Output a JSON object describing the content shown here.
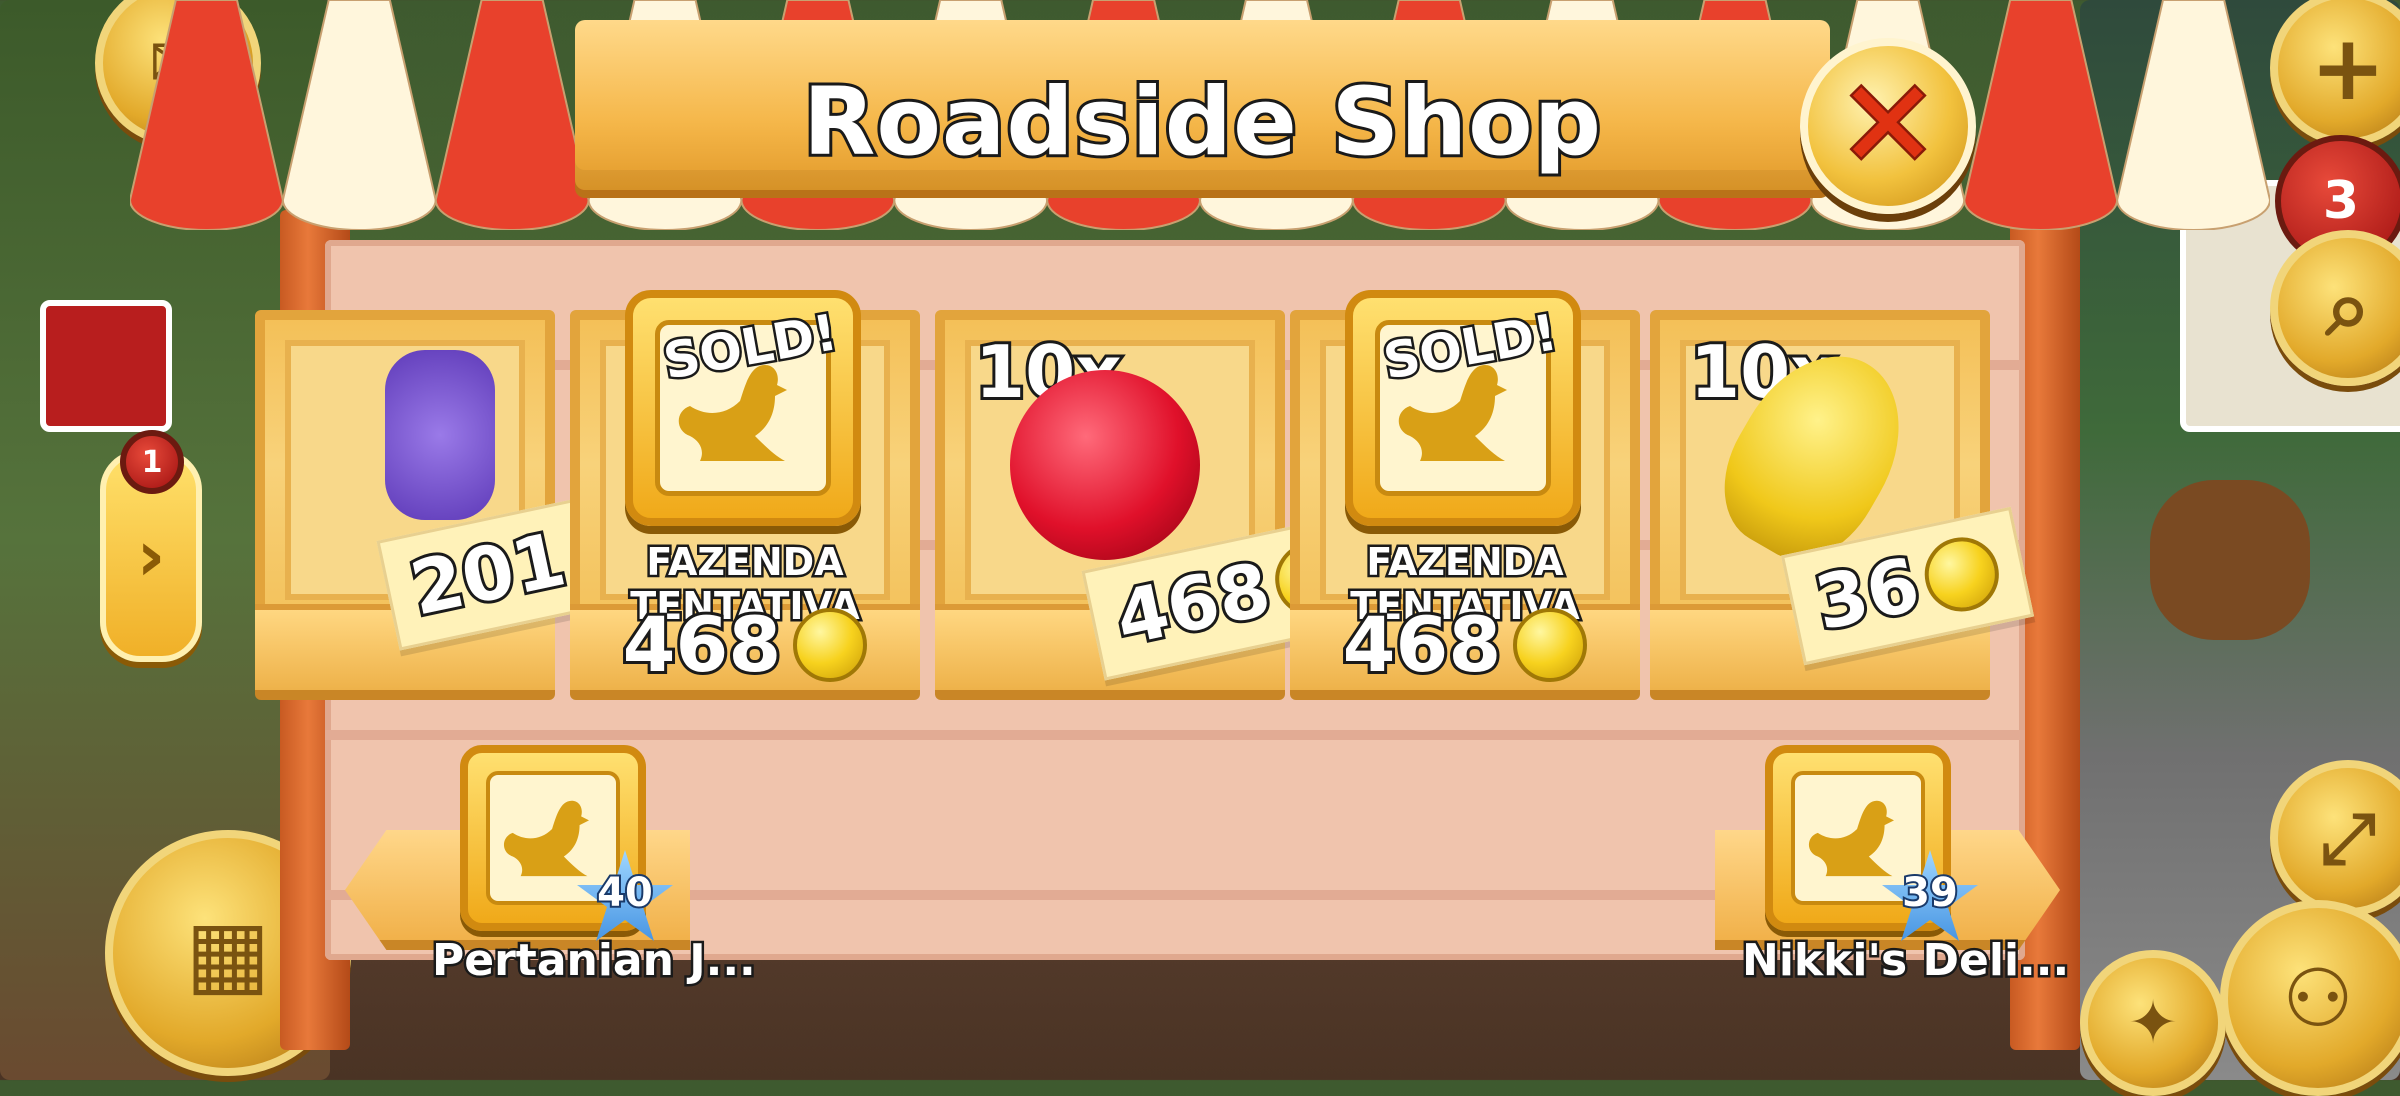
{
  "title": "Roadside Shop",
  "close_icon": "close-x-icon",
  "slots": [
    {
      "kind": "item",
      "item_icon": "lavender-icon",
      "price": "201"
    },
    {
      "kind": "sold",
      "sold_label": "SOLD!",
      "buyer": "FAZENDA TENTATIVA",
      "price": "468"
    },
    {
      "kind": "item",
      "quantity": "10x",
      "item_icon": "raspberry-icon",
      "price": "468"
    },
    {
      "kind": "sold",
      "sold_label": "SOLD!",
      "buyer": "FAZENDA TENTATIVA",
      "price": "468"
    },
    {
      "kind": "item",
      "quantity": "10x",
      "item_icon": "wheat-icon",
      "price": "36"
    }
  ],
  "neighbors": {
    "left": {
      "name": "Pertanian J...",
      "level": "40"
    },
    "right": {
      "name": "Nikki's Deli...",
      "level": "39"
    }
  },
  "hud": {
    "notification_count": "1",
    "badge_count": "3",
    "coins_partial": "201"
  },
  "colors": {
    "awning_red": "#e8412c",
    "awning_white": "#fff6dc",
    "plank": "#f5b74a",
    "coin": "#f7d21e"
  }
}
